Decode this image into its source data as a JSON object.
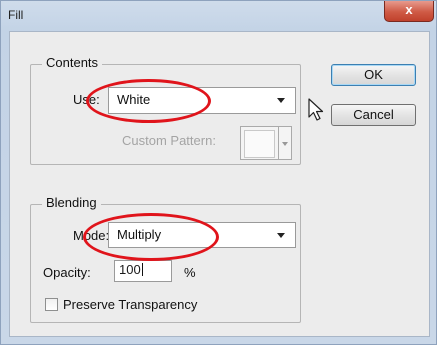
{
  "window": {
    "title": "Fill",
    "close_label": "x"
  },
  "buttons": {
    "ok": "OK",
    "cancel": "Cancel"
  },
  "contents": {
    "legend": "Contents",
    "use_label": "Use:",
    "use_value": "White",
    "custom_pattern_label": "Custom Pattern:"
  },
  "blending": {
    "legend": "Blending",
    "mode_label": "Mode:",
    "mode_value": "Multiply",
    "opacity_label": "Opacity:",
    "opacity_value": "100",
    "opacity_unit": "%",
    "preserve_label": "Preserve Transparency",
    "preserve_checked": false
  },
  "colors": {
    "highlight_ellipse": "#e0141b",
    "accent_border": "#3c7fb1"
  },
  "icons": [
    "close-icon",
    "dropdown-arrow-icon",
    "mouse-pointer-icon"
  ]
}
